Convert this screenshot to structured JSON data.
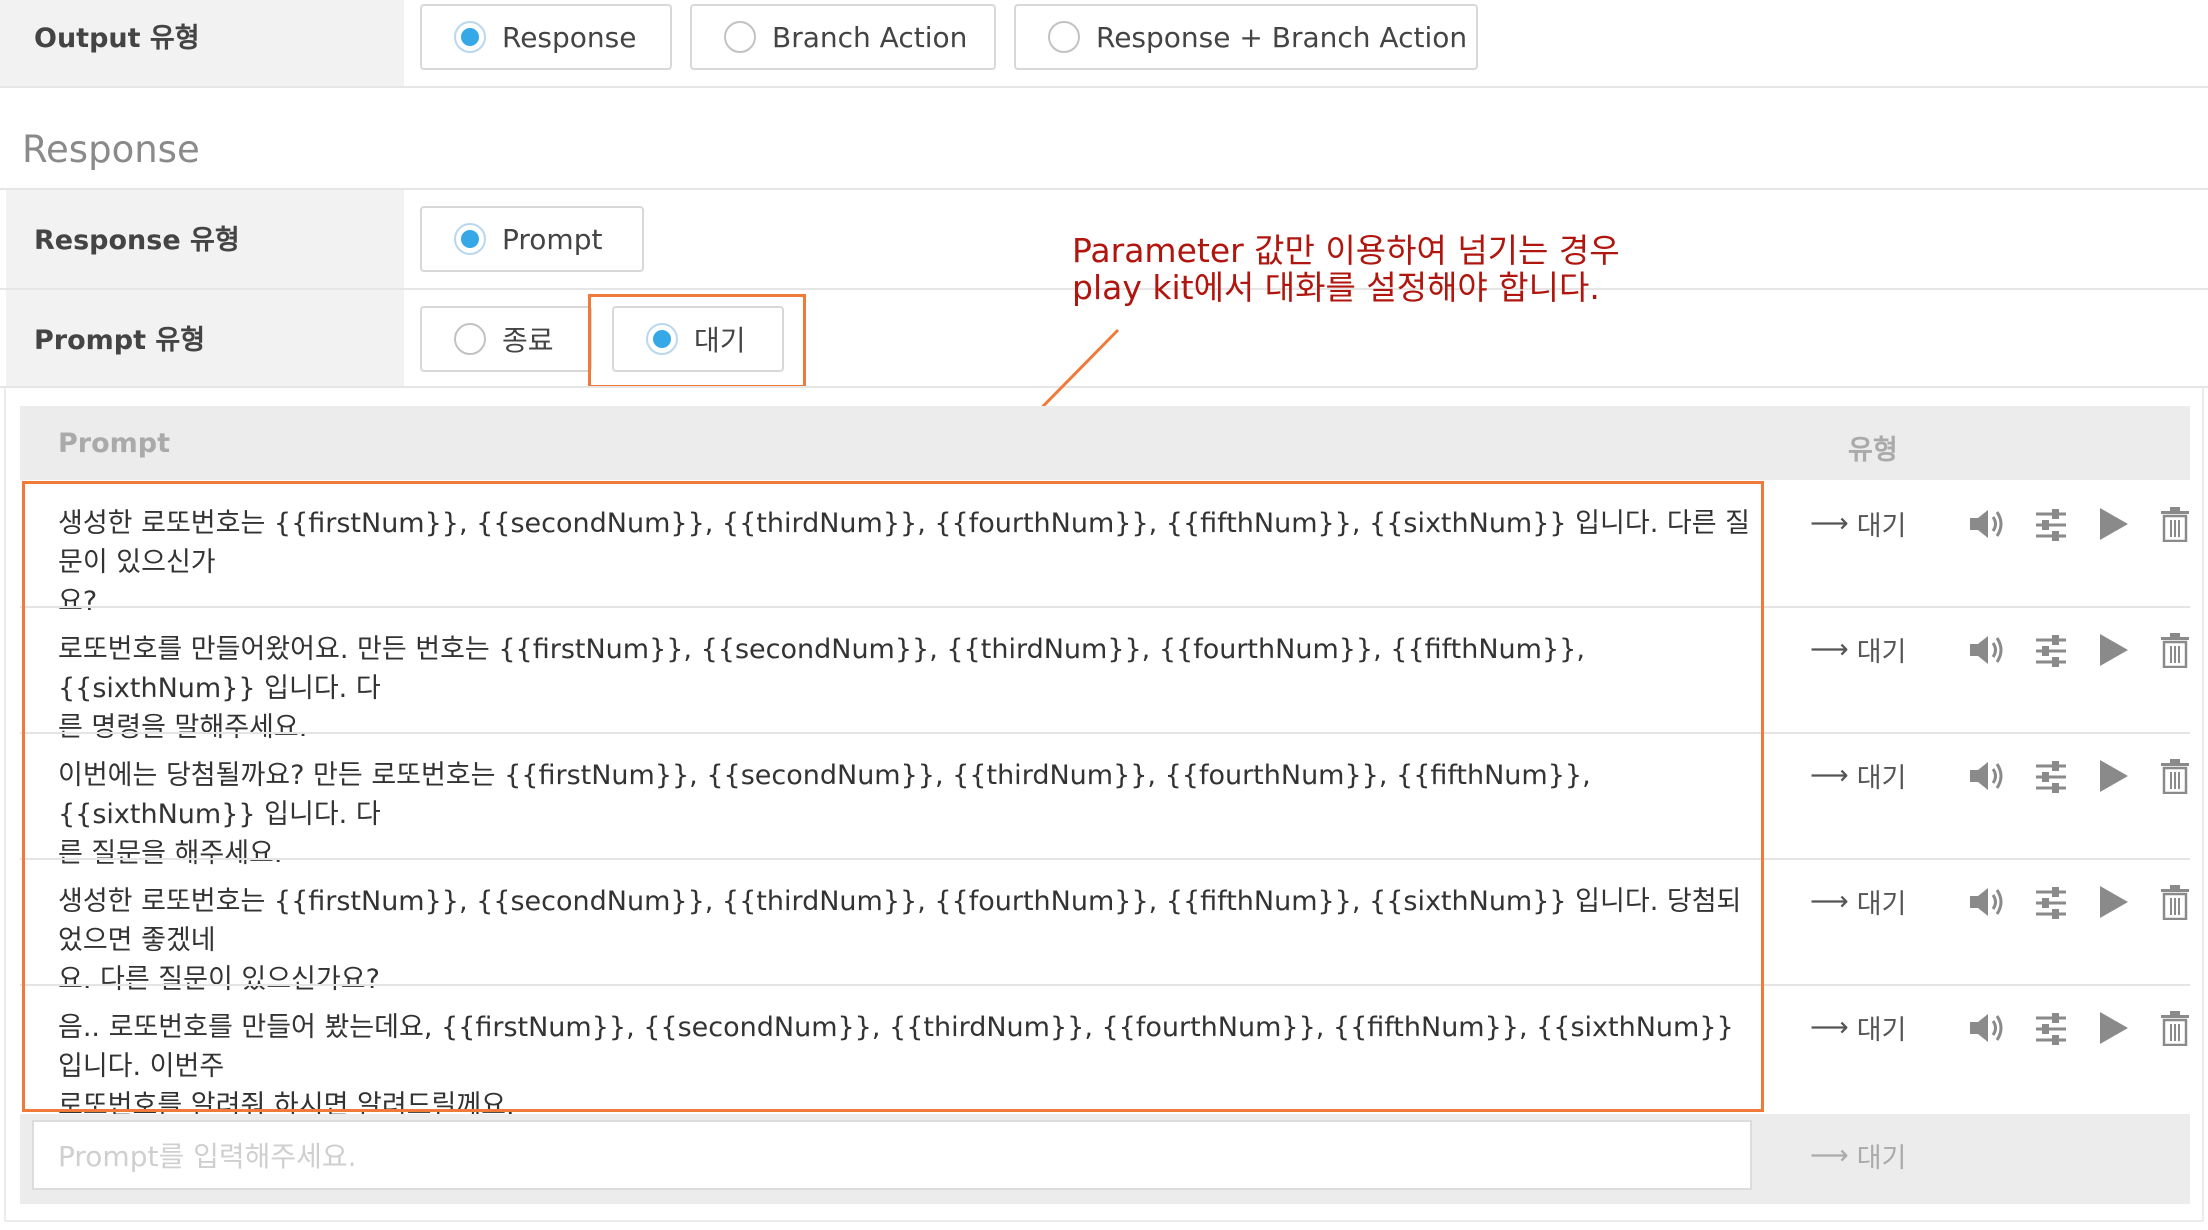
{
  "output_type": {
    "label": "Output 유형",
    "options": [
      {
        "label": "Response",
        "selected": true
      },
      {
        "label": "Branch Action",
        "selected": false
      },
      {
        "label": "Response + Branch Action",
        "selected": false
      }
    ]
  },
  "response_section": {
    "title": "Response",
    "response_type": {
      "label": "Response 유형",
      "option": "Prompt"
    },
    "prompt_type": {
      "label": "Prompt 유형",
      "options": [
        {
          "label": "종료",
          "selected": false
        },
        {
          "label": "대기",
          "selected": true
        }
      ]
    }
  },
  "annotation": {
    "line1": "Parameter 값만 이용하여 넘기는 경우",
    "line2": "play kit에서 대화를 설정해야 합니다.",
    "color": "#b0150e"
  },
  "prompt_table": {
    "headers": {
      "prompt": "Prompt",
      "type": "유형"
    },
    "rows": [
      {
        "line1": "생성한 로또번호는 {{firstNum}}, {{secondNum}}, {{thirdNum}}, {{fourthNum}}, {{fifthNum}}, {{sixthNum}} 입니다. 다른 질문이 있으신가",
        "line2": "요?",
        "type": "대기"
      },
      {
        "line1": "로또번호를 만들어왔어요. 만든 번호는 {{firstNum}}, {{secondNum}}, {{thirdNum}}, {{fourthNum}}, {{fifthNum}}, {{sixthNum}} 입니다. 다",
        "line2": "른 명령을 말해주세요.",
        "type": "대기"
      },
      {
        "line1": "이번에는 당첨될까요? 만든 로또번호는 {{firstNum}}, {{secondNum}}, {{thirdNum}}, {{fourthNum}}, {{fifthNum}}, {{sixthNum}} 입니다. 다",
        "line2": "른 질문을 해주세요.",
        "type": "대기"
      },
      {
        "line1": "생성한 로또번호는 {{firstNum}}, {{secondNum}}, {{thirdNum}}, {{fourthNum}}, {{fifthNum}}, {{sixthNum}} 입니다. 당첨되었으면 좋겠네",
        "line2": "요. 다른 질문이 있으신가요?",
        "type": "대기"
      },
      {
        "line1": "음.. 로또번호를 만들어 봤는데요, {{firstNum}}, {{secondNum}}, {{thirdNum}}, {{fourthNum}}, {{fifthNum}}, {{sixthNum}} 입니다. 이번주",
        "line2": "로또번호를 알려줘 하시면 알려드릴께요.",
        "type": "대기"
      }
    ],
    "input_placeholder": "Prompt를 입력해주세요.",
    "input_type": "대기",
    "row_icons": [
      "arrow-right-icon",
      "speaker-icon",
      "sliders-icon",
      "play-icon",
      "trash-icon"
    ]
  },
  "colors": {
    "radio_selected": "#36a8e8",
    "highlight_border": "#f07a3a",
    "label_bg": "#f2f2f2",
    "table_header_bg": "#ececec"
  }
}
